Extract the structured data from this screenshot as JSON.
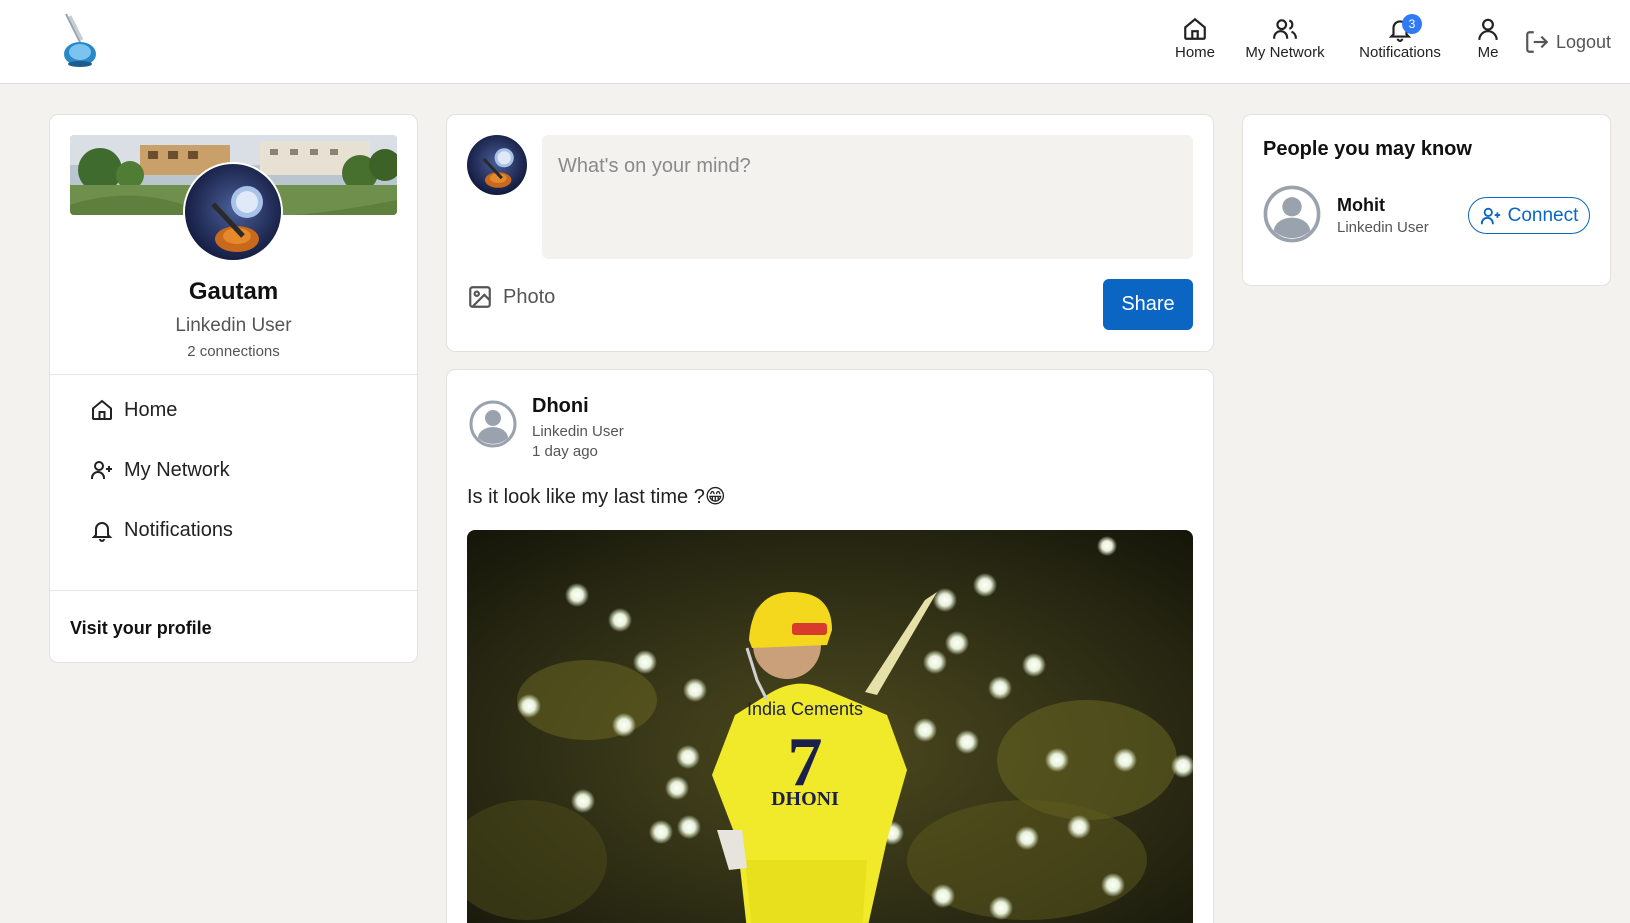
{
  "nav": {
    "home_label": "Home",
    "network_label": "My Network",
    "notifications_label": "Notifications",
    "notifications_count": "3",
    "me_label": "Me",
    "logout_label": "Logout"
  },
  "profile": {
    "name": "Gautam",
    "title": "Linkedin User",
    "connections": "2 connections",
    "links": [
      {
        "label": "Home",
        "icon": "home-icon"
      },
      {
        "label": "My Network",
        "icon": "add-user-icon"
      },
      {
        "label": "Notifications",
        "icon": "bell-icon"
      }
    ],
    "visit_label": "Visit your profile"
  },
  "composer": {
    "placeholder": "What's on your mind?",
    "photo_label": "Photo",
    "share_label": "Share"
  },
  "post": {
    "author": "Dhoni",
    "author_title": "Linkedin User",
    "time": "1 day ago",
    "text": "Is it look like my last time ?😁",
    "jersey_sponsor": "India Cements",
    "jersey_number": "7",
    "jersey_name": "DHONI"
  },
  "suggestions": {
    "title": "People you may know",
    "people": [
      {
        "name": "Mohit",
        "title": "Linkedin User",
        "action": "Connect"
      }
    ]
  },
  "colors": {
    "accent": "#0a66c2",
    "background": "#f3f2ef",
    "badge": "#2f7bf5"
  }
}
